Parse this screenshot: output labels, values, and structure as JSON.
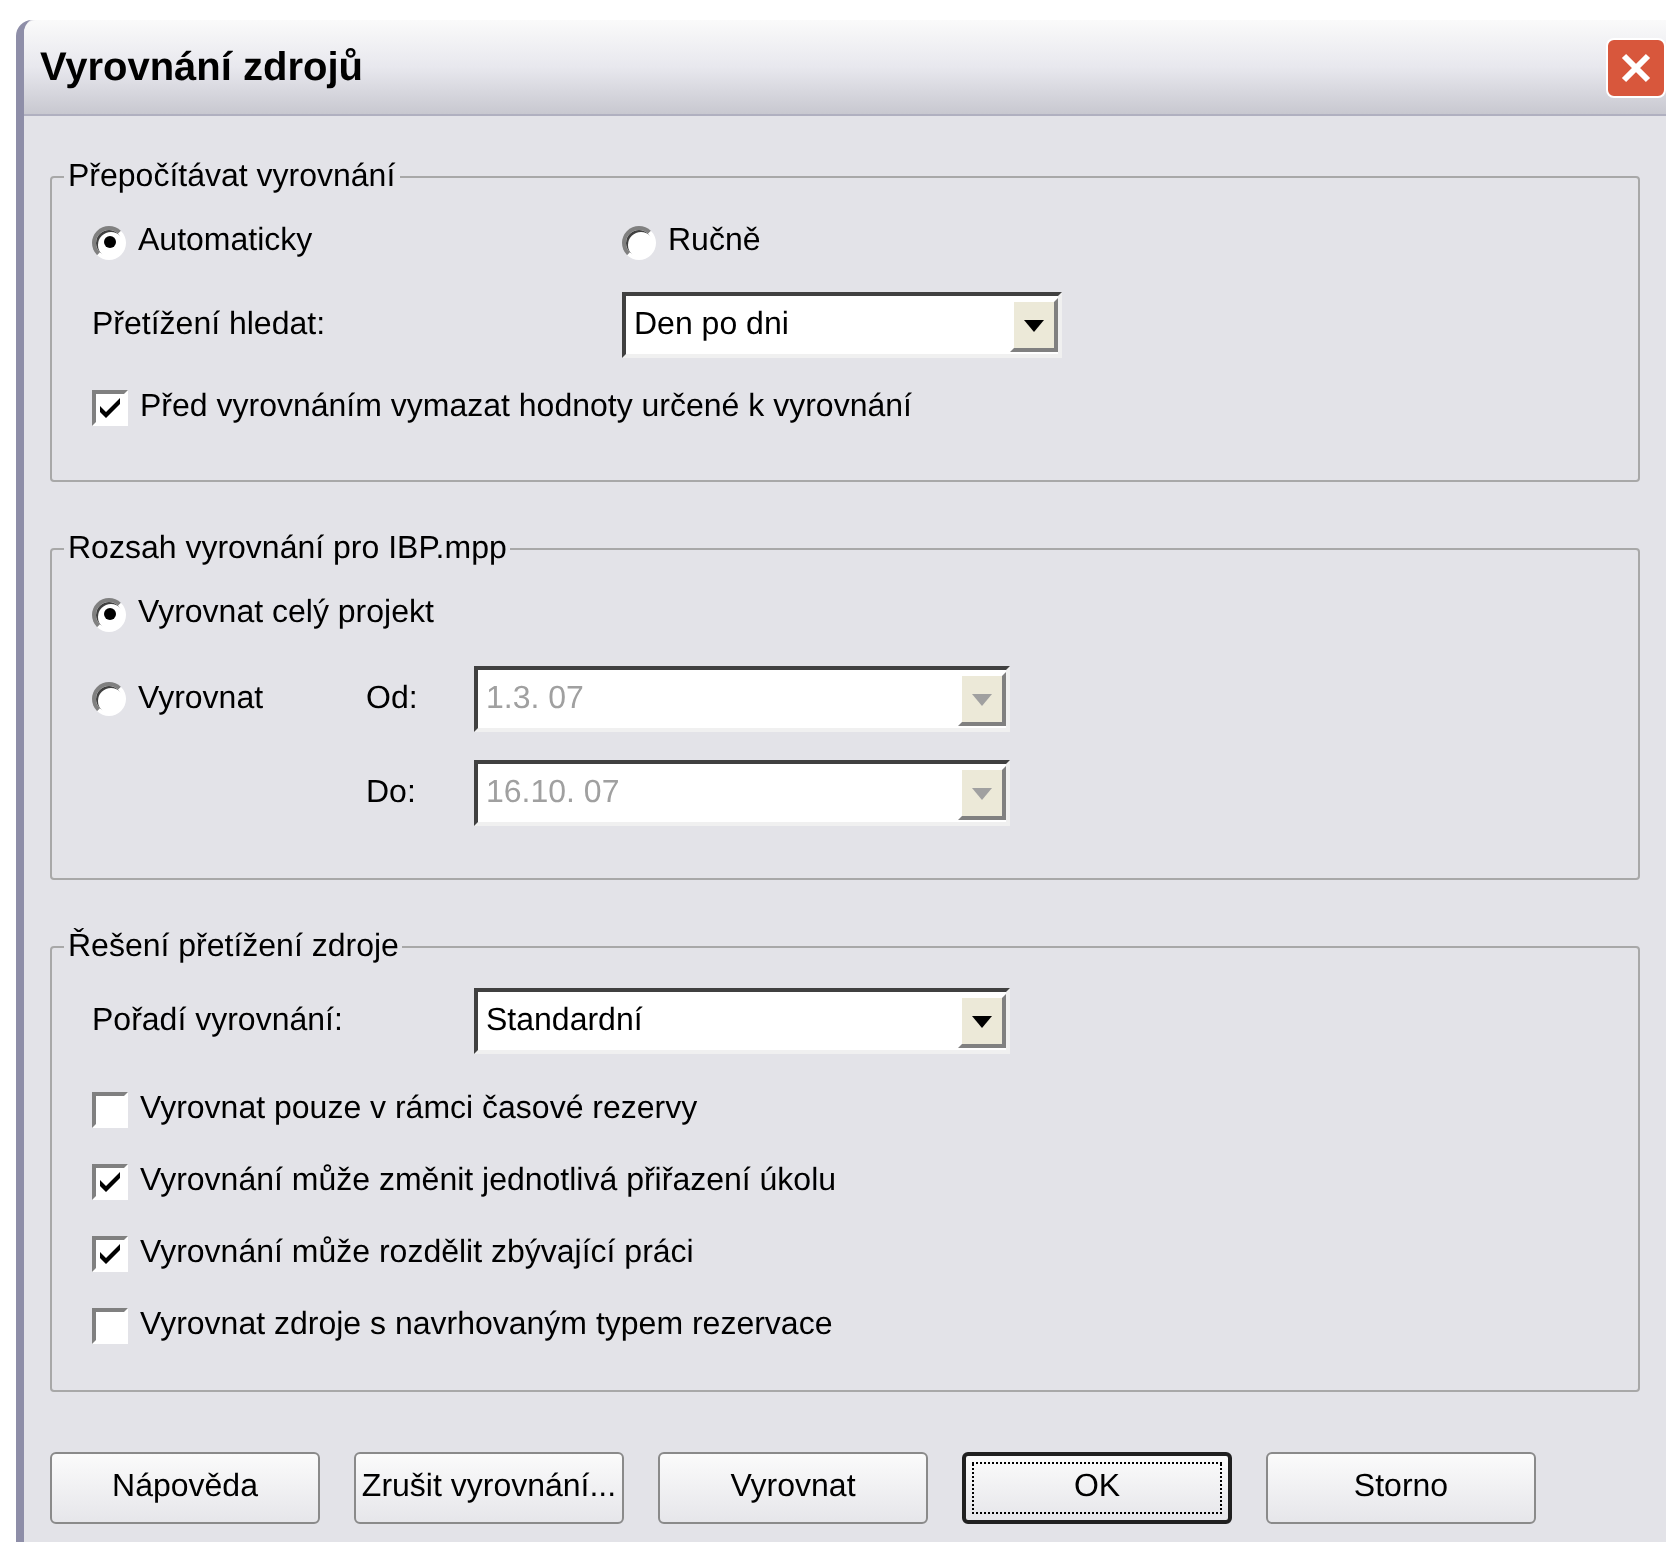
{
  "window": {
    "title": "Vyrovnání zdrojů"
  },
  "recalculate": {
    "legend": "Přepočítávat vyrovnání",
    "modes": [
      {
        "label": "Automaticky",
        "selected": true
      },
      {
        "label": "Ručně",
        "selected": false
      }
    ],
    "overload_label": "Přetížení hledat:",
    "overload_value": "Den po dni",
    "clear_option": {
      "label": "Před vyrovnáním vymazat hodnoty určené k vyrovnání",
      "checked": true
    }
  },
  "range": {
    "legend": "Rozsah vyrovnání pro IBP.mpp",
    "whole": {
      "label": "Vyrovnat celý projekt",
      "selected": true
    },
    "partial": {
      "label": "Vyrovnat",
      "selected": false
    },
    "from": {
      "label": "Od:",
      "value": "1.3. 07",
      "disabled": true
    },
    "to": {
      "label": "Do:",
      "value": "16.10. 07",
      "disabled": true
    }
  },
  "resolution": {
    "legend": "Řešení přetížení zdroje",
    "order_label": "Pořadí vyrovnání:",
    "order_value": "Standardní",
    "options": [
      {
        "label": "Vyrovnat pouze v rámci časové rezervy",
        "checked": false
      },
      {
        "label": "Vyrovnání může změnit jednotlivá přiřazení úkolu",
        "checked": true
      },
      {
        "label": "Vyrovnání může rozdělit zbývající práci",
        "checked": true
      },
      {
        "label": "Vyrovnat zdroje s navrhovaným typem rezervace",
        "checked": false
      }
    ]
  },
  "buttons": [
    {
      "label": "Nápověda",
      "default": false
    },
    {
      "label": "Zrušit vyrovnání...",
      "default": false
    },
    {
      "label": "Vyrovnat",
      "default": false
    },
    {
      "label": "OK",
      "default": true
    },
    {
      "label": "Storno",
      "default": false
    }
  ]
}
